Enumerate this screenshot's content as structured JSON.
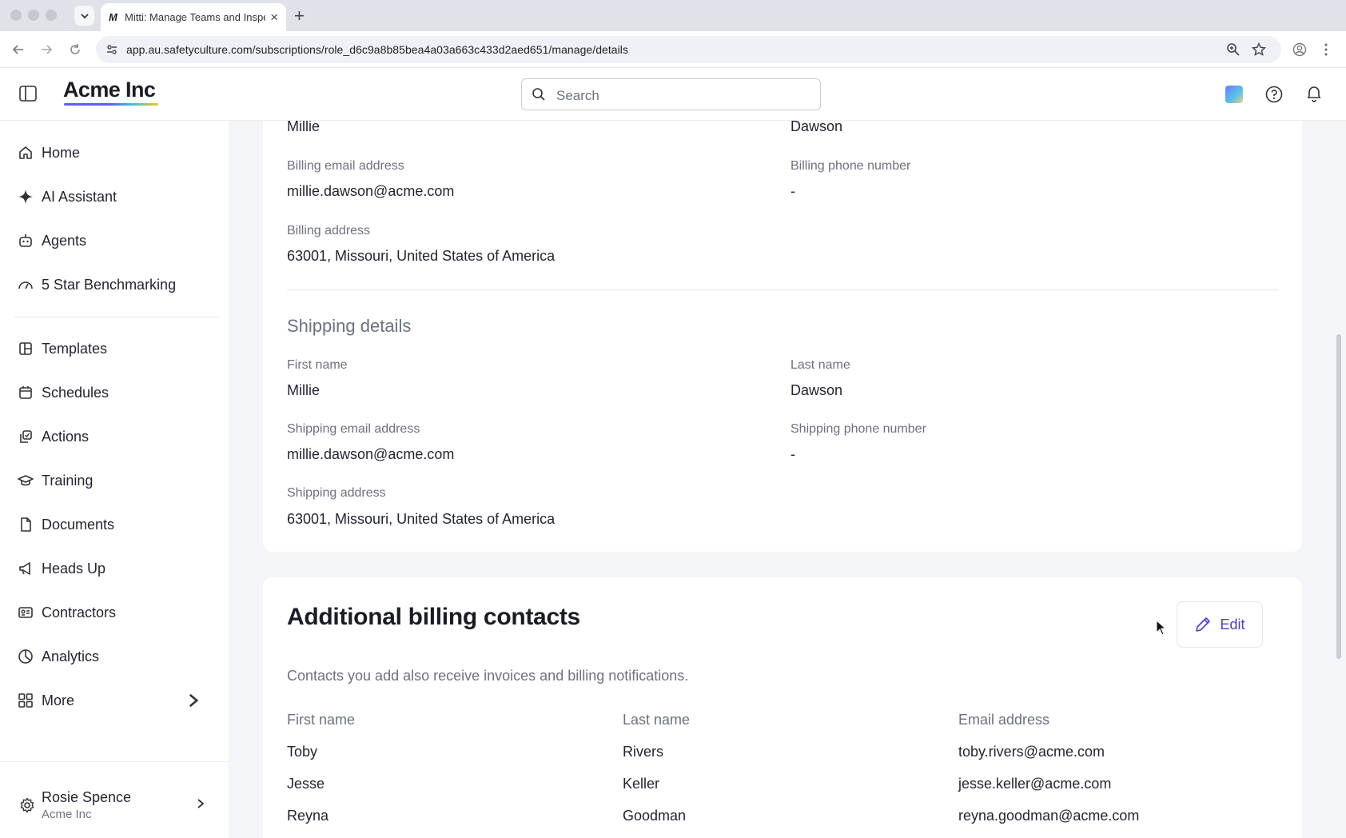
{
  "browser": {
    "tab_title": "Mitti: Manage Teams and Inspections",
    "tab_favicon": "M",
    "url": "app.au.safetyculture.com/subscriptions/role_d6c9a8b85bea4a03a663c433d2aed651/manage/details"
  },
  "header": {
    "logo": "Acme Inc",
    "search_placeholder": "Search"
  },
  "sidebar": {
    "items": [
      {
        "label": "Home",
        "icon": "home-icon"
      },
      {
        "label": "AI Assistant",
        "icon": "sparkle-icon"
      },
      {
        "label": "Agents",
        "icon": "robot-icon"
      },
      {
        "label": "5 Star Benchmarking",
        "icon": "gauge-icon"
      },
      {
        "label": "Templates",
        "icon": "template-icon"
      },
      {
        "label": "Schedules",
        "icon": "calendar-icon"
      },
      {
        "label": "Actions",
        "icon": "actions-icon"
      },
      {
        "label": "Training",
        "icon": "graduation-cap-icon"
      },
      {
        "label": "Documents",
        "icon": "document-icon"
      },
      {
        "label": "Heads Up",
        "icon": "megaphone-icon"
      },
      {
        "label": "Contractors",
        "icon": "id-card-icon"
      },
      {
        "label": "Analytics",
        "icon": "pie-chart-icon"
      },
      {
        "label": "More",
        "icon": "grid-icon"
      }
    ],
    "profile": {
      "name": "Rosie Spence",
      "org": "Acme Inc"
    }
  },
  "billing": {
    "first_name": "Millie",
    "last_name": "Dawson",
    "email_label": "Billing email address",
    "email": "millie.dawson@acme.com",
    "phone_label": "Billing phone number",
    "phone": "-",
    "address_label": "Billing address",
    "address": "63001, Missouri, United States of America"
  },
  "shipping": {
    "title": "Shipping details",
    "first_name_label": "First name",
    "first_name": "Millie",
    "last_name_label": "Last name",
    "last_name": "Dawson",
    "email_label": "Shipping email address",
    "email": "millie.dawson@acme.com",
    "phone_label": "Shipping phone number",
    "phone": "-",
    "address_label": "Shipping address",
    "address": "63001, Missouri, United States of America"
  },
  "contacts": {
    "title": "Additional billing contacts",
    "subtitle": "Contacts you add also receive invoices and billing notifications.",
    "edit_label": "Edit",
    "columns": [
      "First name",
      "Last name",
      "Email address"
    ],
    "rows": [
      [
        "Toby",
        "Rivers",
        "toby.rivers@acme.com"
      ],
      [
        "Jesse",
        "Keller",
        "jesse.keller@acme.com"
      ],
      [
        "Reyna",
        "Goodman",
        "reyna.goodman@acme.com"
      ]
    ]
  }
}
